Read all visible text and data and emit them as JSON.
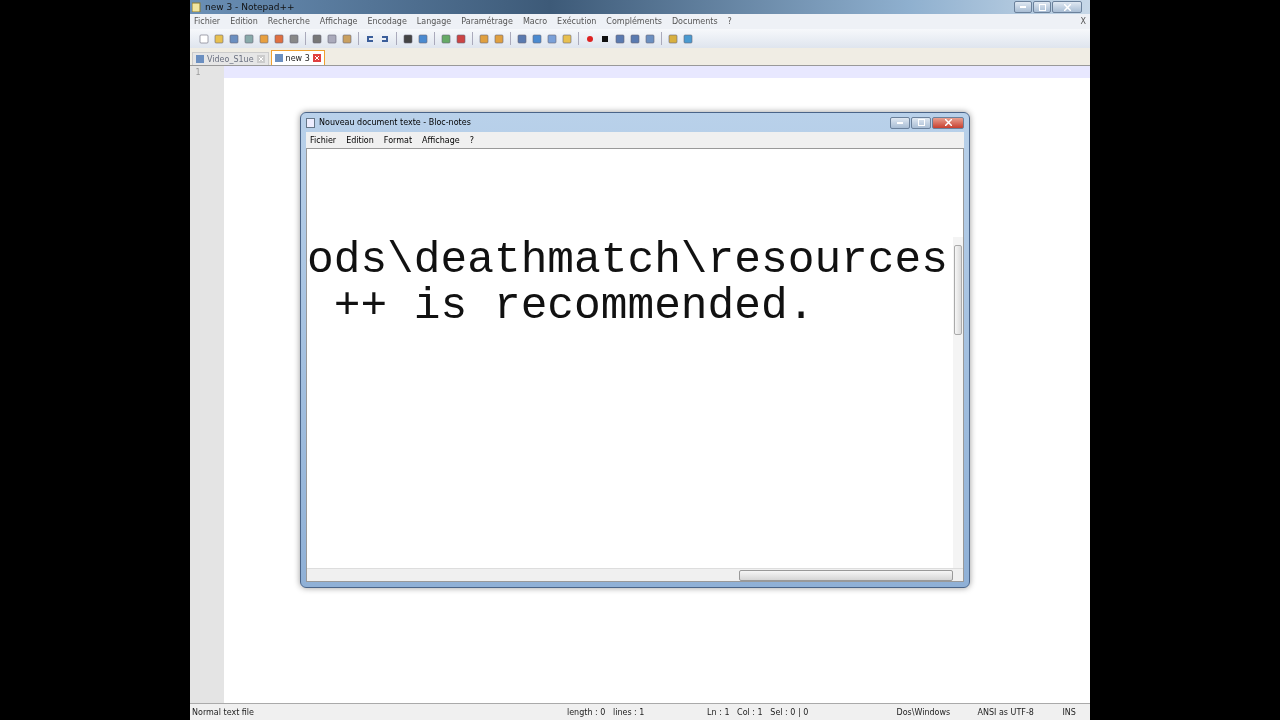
{
  "window": {
    "title": "new 3 - Notepad++"
  },
  "menu": [
    "Fichier",
    "Edition",
    "Recherche",
    "Affichage",
    "Encodage",
    "Langage",
    "Paramétrage",
    "Macro",
    "Exécution",
    "Compléments",
    "Documents",
    "?"
  ],
  "menu_close": "X",
  "tabs": [
    {
      "label": "Video_S1ue",
      "selected": false
    },
    {
      "label": "new 3",
      "selected": true
    }
  ],
  "editor": {
    "line_numbers": [
      "1"
    ]
  },
  "notepad": {
    "title": "Nouveau document texte - Bloc-notes",
    "menu": [
      "Fichier",
      "Edition",
      "Format",
      "Affichage",
      "?"
    ],
    "lines": [
      "ods\\deathmatch\\resources",
      " ++ is recommended."
    ]
  },
  "status_bar": [
    "Normal text file",
    "length : 0   lines : 1",
    "Ln : 1   Col : 1   Sel : 0 | 0",
    "Dos\\Windows",
    "ANSI as UTF-8",
    "INS"
  ]
}
